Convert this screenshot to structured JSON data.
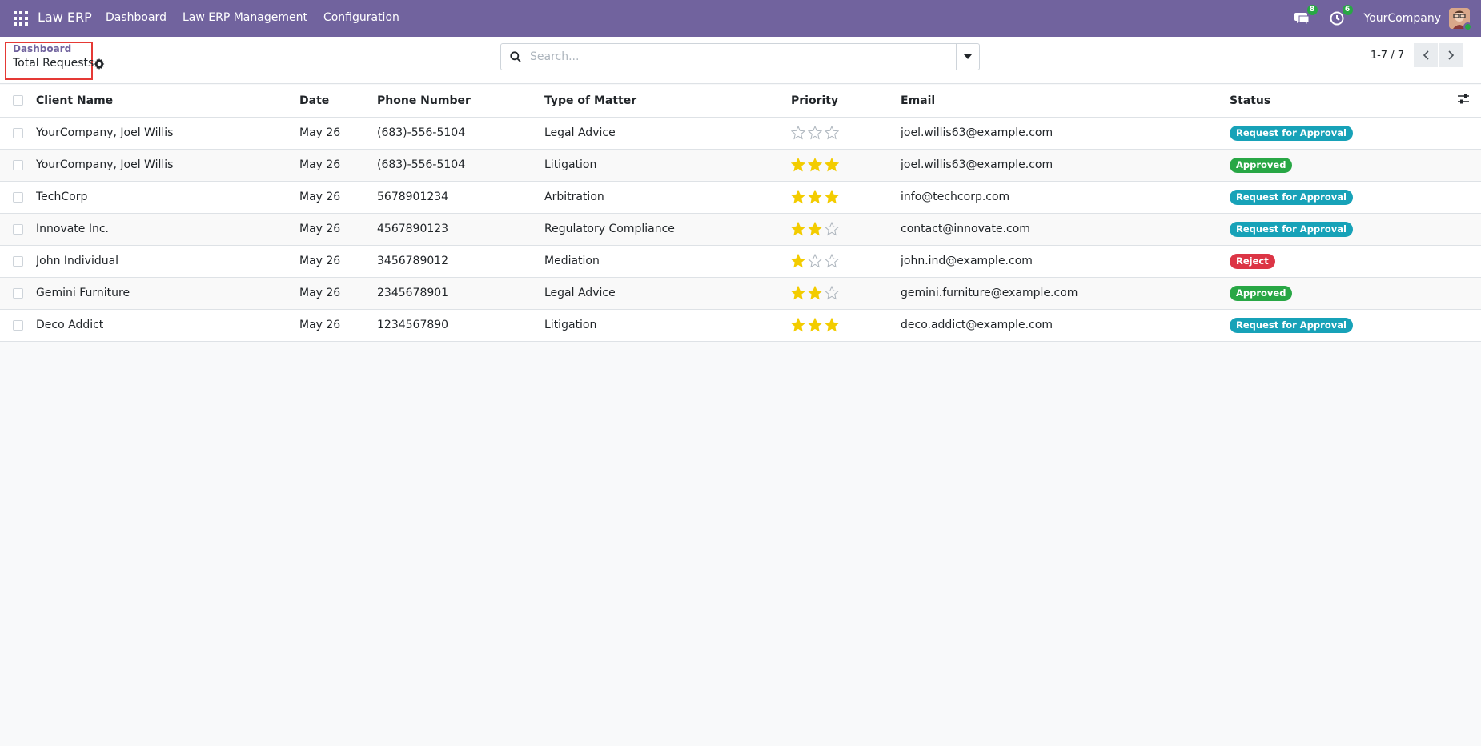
{
  "navbar": {
    "brand": "Law ERP",
    "menu": [
      "Dashboard",
      "Law ERP Management",
      "Configuration"
    ],
    "messages_count": "8",
    "activities_count": "6",
    "company": "YourCompany",
    "color": "#71639e"
  },
  "control": {
    "breadcrumb_parent": "Dashboard",
    "breadcrumb_current": "Total Requests",
    "search_placeholder": "Search...",
    "pager": "1-7 / 7"
  },
  "table": {
    "columns": [
      "Client Name",
      "Date",
      "Phone Number",
      "Type of Matter",
      "Priority",
      "Email",
      "Status"
    ],
    "rows": [
      {
        "client": "YourCompany, Joel Willis",
        "date": "May 26",
        "phone": "(683)-556-5104",
        "matter": "Legal Advice",
        "priority": 0,
        "email": "joel.willis63@example.com",
        "status": "Request for Approval"
      },
      {
        "client": "YourCompany, Joel Willis",
        "date": "May 26",
        "phone": "(683)-556-5104",
        "matter": "Litigation",
        "priority": 3,
        "email": "joel.willis63@example.com",
        "status": "Approved"
      },
      {
        "client": "TechCorp",
        "date": "May 26",
        "phone": "5678901234",
        "matter": "Arbitration",
        "priority": 3,
        "email": "info@techcorp.com",
        "status": "Request for Approval"
      },
      {
        "client": "Innovate Inc.",
        "date": "May 26",
        "phone": "4567890123",
        "matter": "Regulatory Compliance",
        "priority": 2,
        "email": "contact@innovate.com",
        "status": "Request for Approval"
      },
      {
        "client": "John Individual",
        "date": "May 26",
        "phone": "3456789012",
        "matter": "Mediation",
        "priority": 1,
        "email": "john.ind@example.com",
        "status": "Reject"
      },
      {
        "client": "Gemini Furniture",
        "date": "May 26",
        "phone": "2345678901",
        "matter": "Legal Advice",
        "priority": 2,
        "email": "gemini.furniture@example.com",
        "status": "Approved"
      },
      {
        "client": "Deco Addict",
        "date": "May 26",
        "phone": "1234567890",
        "matter": "Litigation",
        "priority": 3,
        "email": "deco.addict@example.com",
        "status": "Request for Approval"
      }
    ]
  },
  "status_colors": {
    "Request for Approval": "#17a2b8",
    "Approved": "#28a745",
    "Reject": "#dc3545"
  },
  "star_color": "#f3cc00"
}
